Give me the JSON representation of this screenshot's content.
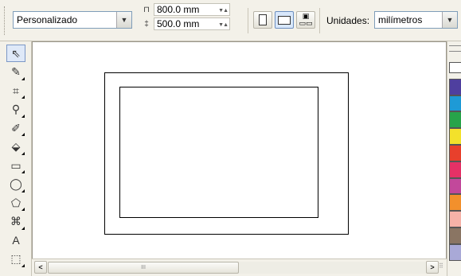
{
  "property_bar": {
    "paper_preset": "Personalizado",
    "paper_width": "800.0 mm",
    "paper_height": "500.0 mm",
    "units_label": "Unidades:",
    "units_value": "milímetros",
    "width_icon": "width-icon",
    "height_icon": "height-icon",
    "orientation_portrait_icon": "portrait-page-icon",
    "orientation_landscape_icon": "landscape-page-icon",
    "page_layout_icon": "page-layout-icon"
  },
  "toolbox": {
    "tools": [
      {
        "name": "pick-tool",
        "glyph": "⇖"
      },
      {
        "name": "shape-tool",
        "glyph": "✎"
      },
      {
        "name": "crop-tool",
        "glyph": "⌗"
      },
      {
        "name": "zoom-tool",
        "glyph": "⚲"
      },
      {
        "name": "freehand-tool",
        "glyph": "✐"
      },
      {
        "name": "smart-fill-tool",
        "glyph": "⬙"
      },
      {
        "name": "rectangle-tool",
        "glyph": "▭"
      },
      {
        "name": "ellipse-tool",
        "glyph": "◯"
      },
      {
        "name": "polygon-tool",
        "glyph": "⬠"
      },
      {
        "name": "basic-shapes-tool",
        "glyph": "⌘"
      },
      {
        "name": "text-tool",
        "glyph": "A"
      },
      {
        "name": "interactive-tool",
        "glyph": "⬚"
      }
    ]
  },
  "palette": {
    "colors": [
      "#ffffff",
      "#4f3f9f",
      "#1e9ad6",
      "#27a44a",
      "#f3e12b",
      "#e8402c",
      "#e53166",
      "#c2489b",
      "#f2902c",
      "#f6b2a8",
      "#8a7563",
      "#a9a9d7"
    ]
  },
  "scrollbar": {
    "left_arrow": "<",
    "right_arrow": ">",
    "thumb_grip": "III"
  }
}
